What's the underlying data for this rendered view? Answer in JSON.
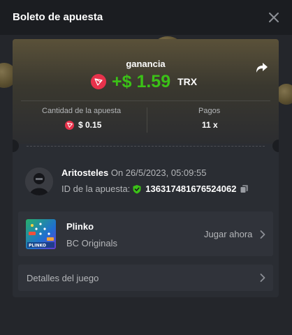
{
  "modal": {
    "title": "Boleto de apuesta"
  },
  "summary": {
    "gain_label": "ganancia",
    "gain_amount": "+$ 1.59",
    "gain_currency": "TRX",
    "bet_amount_label": "Cantidad de la apuesta",
    "bet_amount_value": "$ 0.15",
    "payout_label": "Pagos",
    "payout_value": "11 x"
  },
  "user": {
    "name": "Aritosteles",
    "date_text": "On 26/5/2023, 05:09:55",
    "bet_id_label": "ID de la apuesta:",
    "bet_id": "136317481676524062"
  },
  "game": {
    "name": "Plinko",
    "provider": "BC Originals",
    "play_label": "Jugar ahora",
    "thumb_text": "PLINKO"
  },
  "details": {
    "label": "Detalles del juego"
  },
  "colors": {
    "background": "#1b1d21",
    "card": "#2a2d33",
    "gain_green": "#3bc117",
    "trx_red": "#e8324b",
    "muted_text": "#b4b6b9"
  },
  "icons": [
    "close-icon",
    "share-icon",
    "trx-icon",
    "verified-shield-icon",
    "copy-icon",
    "chevron-right-icon"
  ]
}
